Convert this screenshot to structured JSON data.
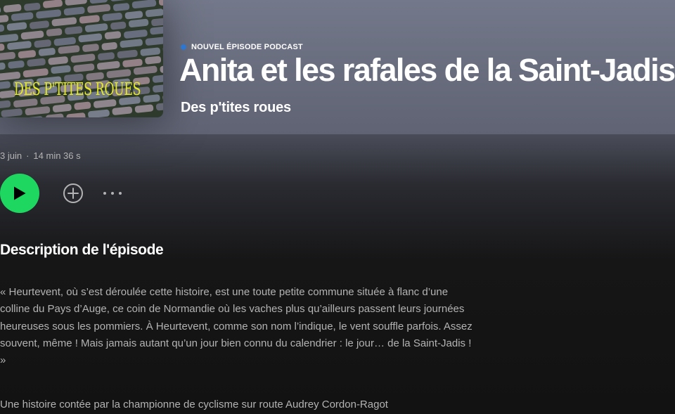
{
  "episode": {
    "type_label": "NOUVEL ÉPISODE PODCAST",
    "title": "Anita et les rafales de la Saint-Jadis",
    "show_name": "Des p'tites roues",
    "cover_text": "DES P'TITES ROUES",
    "date": "3 juin",
    "separator": "·",
    "duration": "14 min 36 s"
  },
  "controls": {
    "play_icon": "play-icon",
    "add_icon": "plus-circle-icon",
    "more_icon": "ellipsis-icon"
  },
  "description": {
    "heading": "Description de l'épisode",
    "body": "« Heurtevent, où s’est déroulée cette histoire, est une toute petite commune située à flanc d’une colline du Pays d’Auge, ce coin de Normandie où les vaches plus qu’ailleurs passent leurs journées heureuses sous les pommiers. À Heurtevent, comme son nom l’indique, le vent souffle parfois. Assez souvent, même ! Mais jamais autant qu’un jour bien connu du calendrier : le jour… de la Saint-Jadis ! »",
    "credit": "Une histoire contée par la championne de cyclisme sur route Audrey Cordon-Ragot"
  },
  "colors": {
    "accent": "#1ed760",
    "new_dot": "#2e77d0",
    "header_bg": "#6b6f80",
    "cover_text": "#e6ea25"
  }
}
